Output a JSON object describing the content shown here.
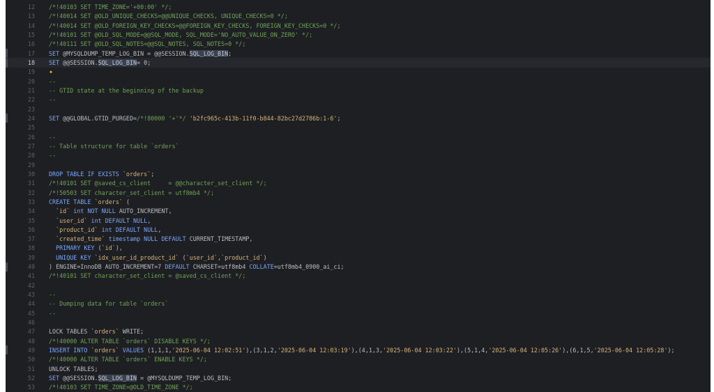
{
  "editor": {
    "current_line": 18,
    "lines": [
      {
        "n": "12",
        "t": [
          [
            "c",
            "/*!40103 SET TIME_ZONE='+00:00' */;"
          ]
        ]
      },
      {
        "n": "13",
        "t": [
          [
            "c",
            "/*!40014 SET @OLD_UNIQUE_CHECKS=@@UNIQUE_CHECKS, UNIQUE_CHECKS=0 */;"
          ]
        ]
      },
      {
        "n": "14",
        "t": [
          [
            "c",
            "/*!40014 SET @OLD_FOREIGN_KEY_CHECKS=@@FOREIGN_KEY_CHECKS, FOREIGN_KEY_CHECKS=0 */;"
          ]
        ]
      },
      {
        "n": "15",
        "t": [
          [
            "c",
            "/*!40101 SET @OLD_SQL_MODE=@@SQL_MODE, SQL_MODE='NO_AUTO_VALUE_ON_ZERO' */;"
          ]
        ]
      },
      {
        "n": "16",
        "t": [
          [
            "c",
            "/*!40111 SET @OLD_SQL_NOTES=@@SQL_NOTES, SQL_NOTES=0 */;"
          ]
        ]
      },
      {
        "n": "17",
        "t": [
          [
            "k",
            "SET "
          ],
          [
            "v",
            "@MYSQLDUMP_TEMP_LOG_BIN = @@SESSION."
          ],
          [
            "h",
            "SQL_LOG_BIN"
          ],
          [
            "v",
            ";"
          ]
        ]
      },
      {
        "n": "18",
        "t": [
          [
            "k",
            "SET "
          ],
          [
            "v",
            "@@SESSION."
          ],
          [
            "h",
            "SQL_LOG_BIN"
          ],
          [
            "v",
            "= 0;"
          ]
        ]
      },
      {
        "n": "19",
        "t": [
          [
            "s",
            "✦"
          ]
        ]
      },
      {
        "n": "20",
        "t": [
          [
            "c",
            "--"
          ]
        ]
      },
      {
        "n": "21",
        "t": [
          [
            "c",
            "-- GTID state at the beginning of the backup"
          ]
        ]
      },
      {
        "n": "22",
        "t": [
          [
            "c",
            "--"
          ]
        ]
      },
      {
        "n": "23",
        "t": []
      },
      {
        "n": "24",
        "t": [
          [
            "k",
            "SET "
          ],
          [
            "v",
            "@@GLOBAL.GTID_PURGED="
          ],
          [
            "c",
            "/*!80000 '+'*/"
          ],
          [
            "v",
            " "
          ],
          [
            "q",
            "'b2fc965c-413b-11f0-b844-82bc27d2786b:1-6'"
          ],
          [
            "v",
            ";"
          ]
        ]
      },
      {
        "n": "25",
        "t": []
      },
      {
        "n": "26",
        "t": [
          [
            "c",
            "--"
          ]
        ]
      },
      {
        "n": "27",
        "t": [
          [
            "c",
            "-- Table structure for table `orders`"
          ]
        ]
      },
      {
        "n": "28",
        "t": [
          [
            "c",
            "--"
          ]
        ]
      },
      {
        "n": "29",
        "t": []
      },
      {
        "n": "30",
        "t": [
          [
            "k",
            "DROP TABLE IF EXISTS "
          ],
          [
            "q",
            "`orders`"
          ],
          [
            "v",
            ";"
          ]
        ]
      },
      {
        "n": "31",
        "t": [
          [
            "c",
            "/*!40101 SET @saved_cs_client     = @@character_set_client */;"
          ]
        ]
      },
      {
        "n": "32",
        "t": [
          [
            "c",
            "/*!50503 SET character_set_client = utf8mb4 */;"
          ]
        ]
      },
      {
        "n": "33",
        "t": [
          [
            "k",
            "CREATE TABLE "
          ],
          [
            "q",
            "`orders`"
          ],
          [
            "v",
            " ("
          ]
        ]
      },
      {
        "n": "34",
        "t": [
          [
            "v",
            "  "
          ],
          [
            "q",
            "`id`"
          ],
          [
            "k",
            " int NOT NULL "
          ],
          [
            "v",
            "AUTO_INCREMENT,"
          ]
        ]
      },
      {
        "n": "35",
        "t": [
          [
            "v",
            "  "
          ],
          [
            "q",
            "`user_id`"
          ],
          [
            "k",
            " int DEFAULT NULL"
          ],
          [
            "v",
            ","
          ]
        ]
      },
      {
        "n": "36",
        "t": [
          [
            "v",
            "  "
          ],
          [
            "q",
            "`product_id`"
          ],
          [
            "k",
            " int DEFAULT NULL"
          ],
          [
            "v",
            ","
          ]
        ]
      },
      {
        "n": "37",
        "t": [
          [
            "v",
            "  "
          ],
          [
            "q",
            "`created_time`"
          ],
          [
            "k",
            " timestamp NULL DEFAULT "
          ],
          [
            "v",
            "CURRENT_TIMESTAMP,"
          ]
        ]
      },
      {
        "n": "38",
        "t": [
          [
            "k",
            "  PRIMARY KEY "
          ],
          [
            "v",
            "("
          ],
          [
            "q",
            "`id`"
          ],
          [
            "v",
            "),"
          ]
        ]
      },
      {
        "n": "39",
        "t": [
          [
            "k",
            "  UNIQUE KEY "
          ],
          [
            "q",
            "`idx_user_id_product_id`"
          ],
          [
            "v",
            " ("
          ],
          [
            "q",
            "`user_id`"
          ],
          [
            "v",
            ","
          ],
          [
            "q",
            "`product_id`"
          ],
          [
            "v",
            ")"
          ]
        ]
      },
      {
        "n": "40",
        "t": [
          [
            "v",
            ") ENGINE=InnoDB AUTO_INCREMENT=7 "
          ],
          [
            "k",
            "DEFAULT "
          ],
          [
            "v",
            "CHARSET=utf8mb4 "
          ],
          [
            "k",
            "COLLATE"
          ],
          [
            "v",
            "=utf8mb4_0900_ai_ci;"
          ]
        ]
      },
      {
        "n": "41",
        "t": [
          [
            "c",
            "/*!40101 SET character_set_client = @saved_cs_client */;"
          ]
        ]
      },
      {
        "n": "42",
        "t": []
      },
      {
        "n": "43",
        "t": [
          [
            "c",
            "--"
          ]
        ]
      },
      {
        "n": "44",
        "t": [
          [
            "c",
            "-- Dumping data for table `orders`"
          ]
        ]
      },
      {
        "n": "45",
        "t": [
          [
            "c",
            "--"
          ]
        ]
      },
      {
        "n": "46",
        "t": []
      },
      {
        "n": "47",
        "t": [
          [
            "v",
            "LOCK TABLES "
          ],
          [
            "q",
            "`orders`"
          ],
          [
            "v",
            " WRITE;"
          ]
        ]
      },
      {
        "n": "48",
        "t": [
          [
            "c",
            "/*!40000 ALTER TABLE `orders` DISABLE KEYS */;"
          ]
        ]
      },
      {
        "n": "49",
        "t": [
          [
            "k",
            "INSERT INTO "
          ],
          [
            "q",
            "`orders`"
          ],
          [
            "k",
            " VALUES "
          ],
          [
            "v",
            "(1,1,1,"
          ],
          [
            "q",
            "'2025-06-04 12:02:51'"
          ],
          [
            "v",
            "),(3,1,2,"
          ],
          [
            "q",
            "'2025-06-04 12:03:19'"
          ],
          [
            "v",
            "),(4,1,3,"
          ],
          [
            "q",
            "'2025-06-04 12:03:22'"
          ],
          [
            "v",
            "),(5,1,4,"
          ],
          [
            "q",
            "'2025-06-04 12:05:26'"
          ],
          [
            "v",
            "),(6,1,5,"
          ],
          [
            "q",
            "'2025-06-04 12:05:28'"
          ],
          [
            "v",
            ");"
          ]
        ]
      },
      {
        "n": "50",
        "t": [
          [
            "c",
            "/*!40000 ALTER TABLE `orders` ENABLE KEYS */;"
          ]
        ]
      },
      {
        "n": "51",
        "t": [
          [
            "v",
            "UNLOCK TABLES;"
          ]
        ]
      },
      {
        "n": "52",
        "t": [
          [
            "k",
            "SET "
          ],
          [
            "v",
            "@@SESSION."
          ],
          [
            "h",
            "SQL_LOG_BIN"
          ],
          [
            "v",
            " = @MYSQLDUMP_TEMP_LOG_BIN;"
          ]
        ]
      },
      {
        "n": "53",
        "t": [
          [
            "c",
            "/*!40103 SET TIME_ZONE=@OLD_TIME_ZONE */;"
          ]
        ]
      },
      {
        "n": "54",
        "t": []
      }
    ]
  },
  "gutter_marks": [
    "17",
    "18",
    "24",
    "40",
    "49"
  ],
  "colors": {
    "background": "#1e1f22",
    "comment": "#6fa35a",
    "keyword": "#7aa7ff",
    "string": "#d6b47a",
    "text": "#bcbec4",
    "highlight": "#3a4150"
  }
}
